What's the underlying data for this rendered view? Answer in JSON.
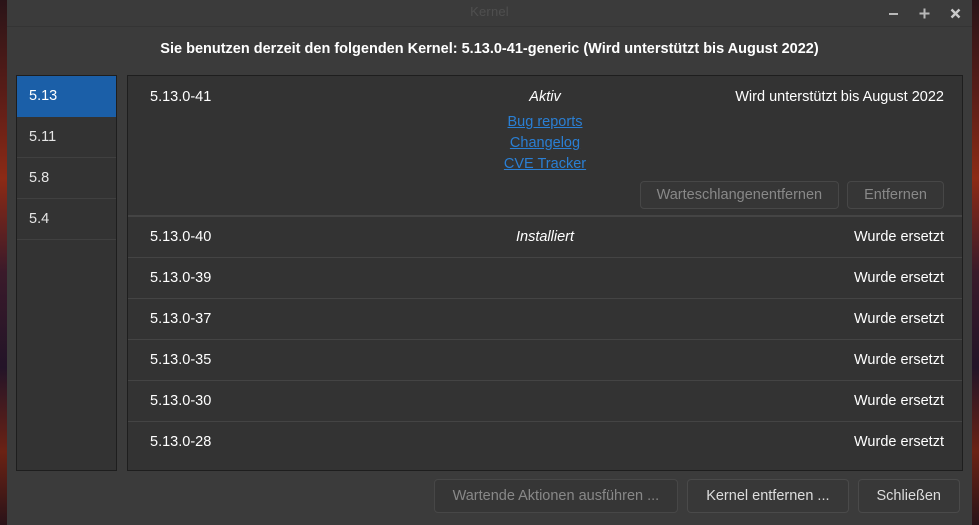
{
  "window": {
    "title": "Kernel",
    "controls": [
      {
        "name": "minimize-button",
        "glyph": "−"
      },
      {
        "name": "maximize-button",
        "glyph": "＋"
      },
      {
        "name": "close-button",
        "glyph": "✕"
      }
    ]
  },
  "header": {
    "title": "Sie benutzen derzeit den folgenden Kernel: 5.13.0-41-generic (Wird unterstützt bis August 2022)"
  },
  "sidebar": {
    "items": [
      {
        "label": "5.13",
        "selected": true
      },
      {
        "label": "5.11",
        "selected": false
      },
      {
        "label": "5.8",
        "selected": false
      },
      {
        "label": "5.4",
        "selected": false
      }
    ]
  },
  "main": {
    "active_entry": {
      "version": "5.13.0-41",
      "state": "Aktiv",
      "support": "Wird unterstützt bis August 2022",
      "links": [
        {
          "label": "Bug reports"
        },
        {
          "label": "Changelog"
        },
        {
          "label": "CVE Tracker"
        }
      ],
      "actions": [
        {
          "label": "Warteschlangenentfernen",
          "disabled": true
        },
        {
          "label": "Entfernen",
          "disabled": true
        }
      ]
    },
    "rows": [
      {
        "version": "5.13.0-40",
        "state": "Installiert",
        "support": "Wurde ersetzt"
      },
      {
        "version": "5.13.0-39",
        "state": "",
        "support": "Wurde ersetzt"
      },
      {
        "version": "5.13.0-37",
        "state": "",
        "support": "Wurde ersetzt"
      },
      {
        "version": "5.13.0-35",
        "state": "",
        "support": "Wurde ersetzt"
      },
      {
        "version": "5.13.0-30",
        "state": "",
        "support": "Wurde ersetzt"
      },
      {
        "version": "5.13.0-28",
        "state": "",
        "support": "Wurde ersetzt"
      }
    ]
  },
  "footer": {
    "buttons": [
      {
        "label": "Wartende Aktionen ausführen ...",
        "disabled": true
      },
      {
        "label": "Kernel entfernen ...",
        "disabled": false
      },
      {
        "label": "Schließen",
        "disabled": false
      }
    ]
  },
  "colors": {
    "window_bg": "#3b3b3b",
    "panel_bg": "#333333",
    "accent_selected": "#1b5fa8",
    "link": "#2a7fd4",
    "text": "#ffffff",
    "text_disabled": "#888888"
  }
}
